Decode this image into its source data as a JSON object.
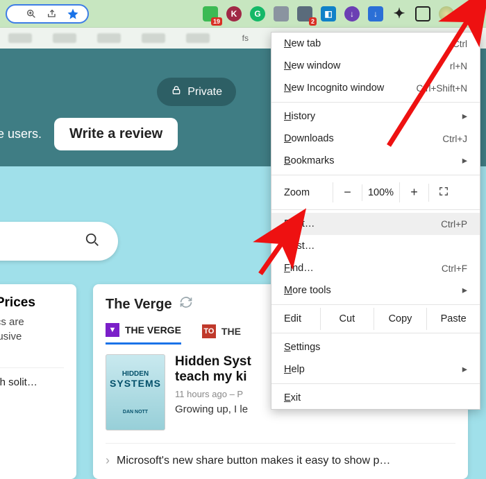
{
  "toolbar": {
    "badge_19": "19",
    "badge_2": "2"
  },
  "bookmarks": {
    "fs_label": "fs"
  },
  "hero": {
    "private_label": "Private",
    "more_users": "ore users.",
    "write_review": "Write a review"
  },
  "left_card": {
    "title": "c Prices",
    "line1": "vacs are",
    "line2": "xclusive",
    "line3": "With solit…"
  },
  "right_card": {
    "source_title": "The Verge",
    "tab1": "THE VERGE",
    "tab2": "THE",
    "thumb_line1": "HIDDEN",
    "thumb_line2": "SYSTEMS",
    "thumb_author": "DAN NOTT",
    "article_title": "Hidden Syst",
    "article_sub": "teach my ki",
    "meta_time": "11 hours ago",
    "meta_sep": "–",
    "meta_author": "P",
    "excerpt": "Growing up, I le",
    "next_title": "Microsoft's new share button makes it easy to show p…"
  },
  "menu": {
    "new_tab": "New tab",
    "new_tab_sc": "Ctrl",
    "new_window": "New window",
    "new_window_sc": "rl+N",
    "new_incog": "New Incognito window",
    "new_incog_sc": "Ctrl+Shift+N",
    "history": "History",
    "downloads": "Downloads",
    "downloads_sc": "Ctrl+J",
    "bookmarks": "Bookmarks",
    "zoom": "Zoom",
    "zoom_minus": "−",
    "zoom_val": "100%",
    "zoom_plus": "+",
    "print": "Print…",
    "print_sc": "Ctrl+P",
    "cast": "Cast…",
    "find": "Find…",
    "find_sc": "Ctrl+F",
    "more_tools": "More tools",
    "edit": "Edit",
    "cut": "Cut",
    "copy": "Copy",
    "paste": "Paste",
    "settings": "Settings",
    "help": "Help",
    "exit": "Exit"
  }
}
